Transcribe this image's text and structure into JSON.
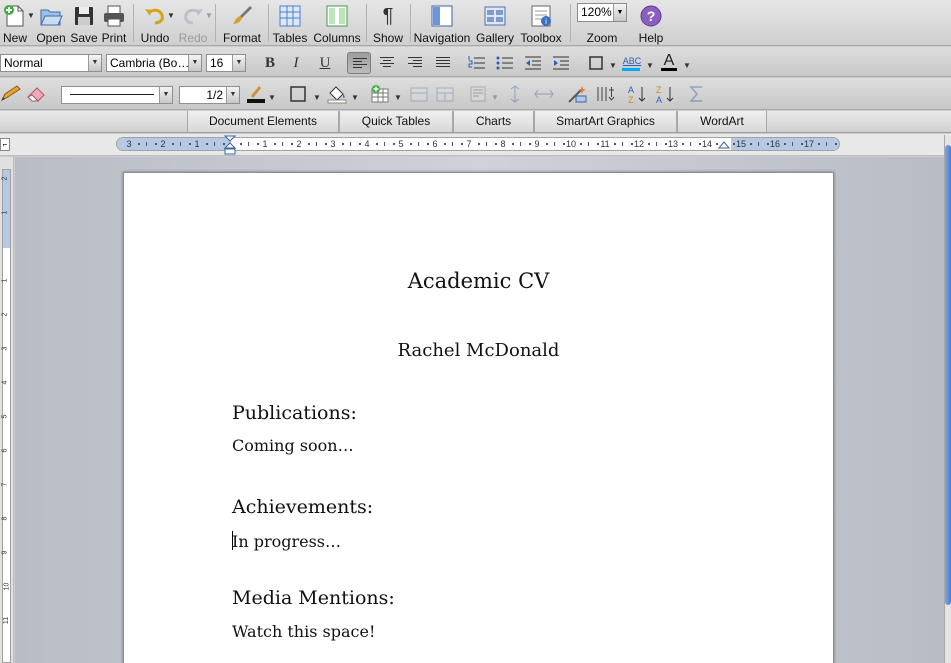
{
  "standard_toolbar": {
    "buttons": [
      {
        "label": "New",
        "icon": "new-document-icon"
      },
      {
        "label": "Open",
        "icon": "open-folder-icon"
      },
      {
        "label": "Save",
        "icon": "floppy-disk-icon"
      },
      {
        "label": "Print",
        "icon": "printer-icon"
      },
      {
        "label": "Undo",
        "icon": "undo-arrow-icon"
      },
      {
        "label": "Redo",
        "icon": "redo-arrow-icon",
        "disabled": true
      },
      {
        "label": "Format",
        "icon": "paintbrush-icon"
      },
      {
        "label": "Tables",
        "icon": "table-grid-icon"
      },
      {
        "label": "Columns",
        "icon": "columns-icon"
      },
      {
        "label": "Show",
        "icon": "pilcrow-icon"
      },
      {
        "label": "Navigation",
        "icon": "navigation-pane-icon"
      },
      {
        "label": "Gallery",
        "icon": "gallery-icon"
      },
      {
        "label": "Toolbox",
        "icon": "toolbox-icon"
      },
      {
        "label": "Zoom",
        "icon": "zoom-icon"
      },
      {
        "label": "Help",
        "icon": "help-icon"
      }
    ],
    "zoom_value": "120%",
    "help_glyph": "?",
    "pilcrow_glyph": "¶"
  },
  "formatting_toolbar": {
    "style": "Normal",
    "font": "Cambria (Bo…",
    "size": "16",
    "bold": "B",
    "italic": "I",
    "underline": "U",
    "highlight_sample": "ABC",
    "font_color_glyph": "A"
  },
  "drawing_toolbar": {
    "line_weight": "1/2"
  },
  "ribbon": {
    "tabs": [
      "Document Elements",
      "Quick Tables",
      "Charts",
      "SmartArt Graphics",
      "WordArt"
    ]
  },
  "ruler": {
    "labels": [
      "3",
      "2",
      "1",
      "1",
      "2",
      "3",
      "4",
      "5",
      "6",
      "7",
      "8",
      "9",
      "10",
      "11",
      "12",
      "13",
      "14",
      "15",
      "16",
      "17"
    ]
  },
  "vertical_ruler": {
    "labels": [
      "2",
      "1",
      "1",
      "2",
      "3",
      "4",
      "5",
      "6",
      "7",
      "8",
      "9",
      "10",
      "11"
    ]
  },
  "colors": {
    "accent": "#4a7dd0",
    "ruler_margin": "#b5c8e4",
    "highlight": "#00a8ff"
  },
  "document": {
    "title": "Academic CV",
    "name": "Rachel McDonald",
    "sections": [
      {
        "heading": "Publications:",
        "body": "Coming soon…"
      },
      {
        "heading": "Achievements:",
        "body": "In progress…"
      },
      {
        "heading": "Media Mentions:",
        "body": "Watch this space!"
      }
    ]
  }
}
